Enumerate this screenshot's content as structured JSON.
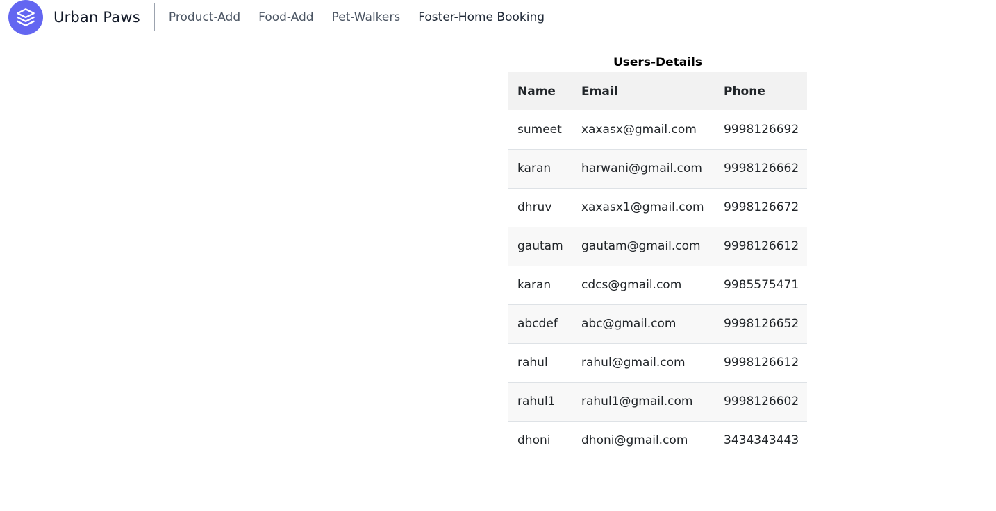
{
  "brand": {
    "name": "Urban Paws",
    "logo_icon": "stack-layers-icon",
    "accent": "#6366f1"
  },
  "nav": {
    "links": [
      "Product-Add",
      "Food-Add",
      "Pet-Walkers",
      "Foster-Home Booking"
    ]
  },
  "users_table": {
    "caption": "Users-Details",
    "columns": [
      "Name",
      "Email",
      "Phone"
    ],
    "rows": [
      [
        "sumeet",
        "xaxasx@gmail.com",
        "9998126692"
      ],
      [
        "karan",
        "harwani@gmail.com",
        "9998126662"
      ],
      [
        "dhruv",
        "xaxasx1@gmail.com",
        "9998126672"
      ],
      [
        "gautam",
        "gautam@gmail.com",
        "9998126612"
      ],
      [
        "karan",
        "cdcs@gmail.com",
        "9985575471"
      ],
      [
        "abcdef",
        "abc@gmail.com",
        "9998126652"
      ],
      [
        "rahul",
        "rahul@gmail.com",
        "9998126612"
      ],
      [
        "rahul1",
        "rahul1@gmail.com",
        "9998126602"
      ],
      [
        "dhoni",
        "dhoni@gmail.com",
        "3434343443"
      ]
    ]
  }
}
